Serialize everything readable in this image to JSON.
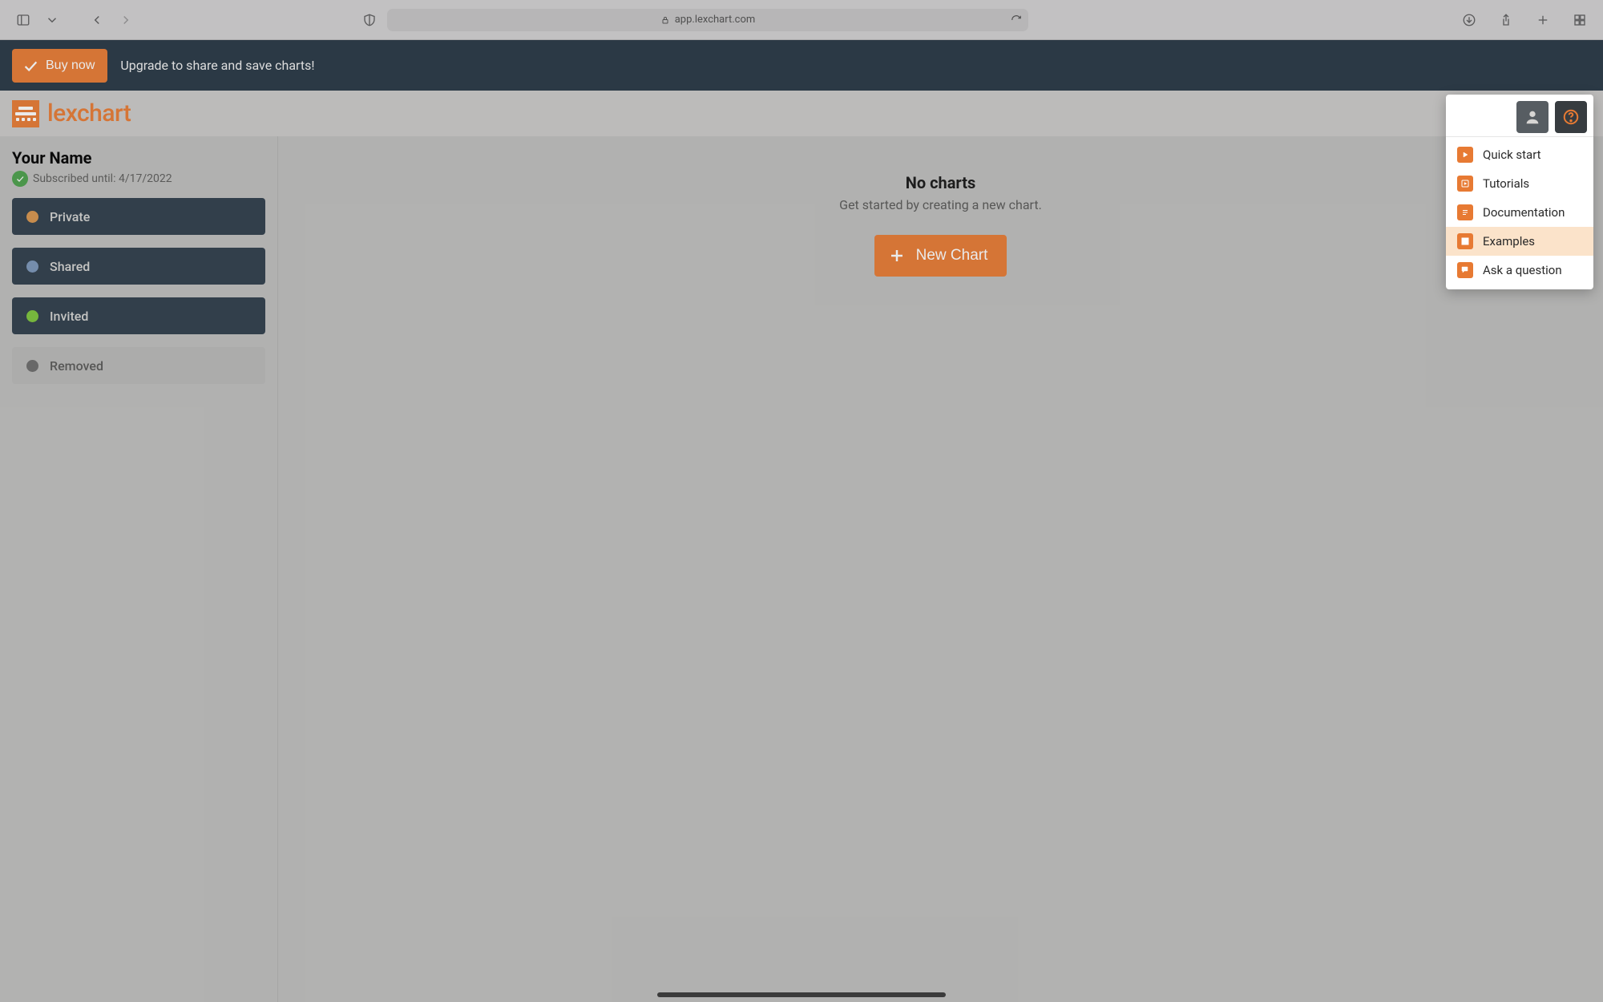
{
  "browser": {
    "url": "app.lexchart.com"
  },
  "banner": {
    "buy_label": "Buy now",
    "upgrade_text": "Upgrade to share and save charts!"
  },
  "logo": {
    "text": "lexchart"
  },
  "sidebar": {
    "title": "Your Name",
    "subscribed_text": "Subscribed until: 4/17/2022",
    "categories": [
      {
        "label": "Private",
        "dot": "orange",
        "variant": "dark"
      },
      {
        "label": "Shared",
        "dot": "blue",
        "variant": "dark"
      },
      {
        "label": "Invited",
        "dot": "green",
        "variant": "dark"
      },
      {
        "label": "Removed",
        "dot": "gray",
        "variant": "light"
      }
    ]
  },
  "main": {
    "empty_title": "No charts",
    "empty_subtitle": "Get started by creating a new chart.",
    "new_chart_label": "New Chart"
  },
  "help_menu": {
    "items": [
      {
        "label": "Quick start",
        "icon": "play"
      },
      {
        "label": "Tutorials",
        "icon": "video"
      },
      {
        "label": "Documentation",
        "icon": "doc"
      },
      {
        "label": "Examples",
        "icon": "grid",
        "hover": true
      },
      {
        "label": "Ask a question",
        "icon": "chat"
      }
    ]
  }
}
